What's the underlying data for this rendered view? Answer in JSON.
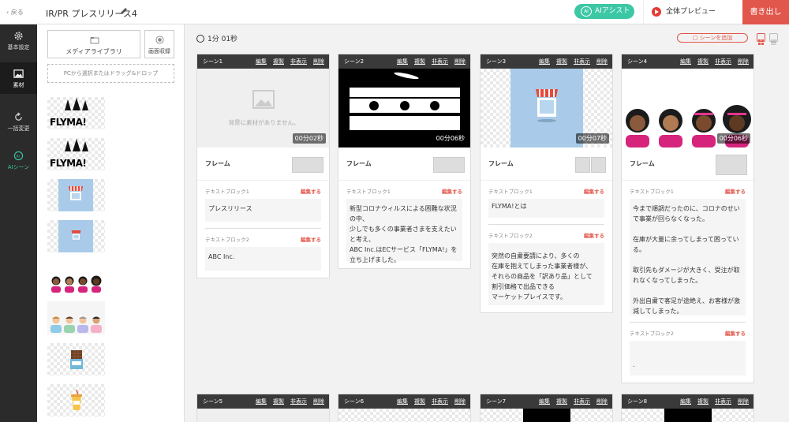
{
  "header": {
    "back": "戻る",
    "title": "IR/PR プレスリリース4",
    "ai_assist": "AIアシスト",
    "preview": "全体プレビュー",
    "export": "書き出し"
  },
  "nav": [
    {
      "label": "基本設定",
      "icon": "gear-icon"
    },
    {
      "label": "素材",
      "icon": "image-icon"
    },
    {
      "label": "一括変更",
      "icon": "refresh-icon"
    },
    {
      "label": "AIシーン",
      "icon": "ai-icon"
    }
  ],
  "library": {
    "media": "メディアライブラリ",
    "record": "画面収録",
    "drop": "PCから選択またはドラッグ&ドロップ",
    "flyma": "FLYMA!"
  },
  "main": {
    "timer": "1分 01秒",
    "add_scene": "シーンを追加"
  },
  "cards": [
    {
      "scene": "シーン1",
      "edit": "編集",
      "copy": "複製",
      "hide": "非表示",
      "del": "削除",
      "empty": "背景に素材がありません。",
      "time": "00分02秒",
      "frame": "フレーム",
      "blocks": [
        {
          "label": "テキストブロック1",
          "edit": "編集する",
          "text": "プレスリリース"
        },
        {
          "label": "テキストブロック2",
          "edit": "編集する",
          "text": "ABC Inc."
        }
      ]
    },
    {
      "scene": "シーン2",
      "edit": "編集",
      "copy": "複製",
      "hide": "非表示",
      "del": "削除",
      "time": "00分06秒",
      "frame": "フレーム",
      "blocks": [
        {
          "label": "テキストブロック1",
          "edit": "編集する",
          "text": "新型コロナウィルスによる困難な状況の中、\n少しでも多くの事業者さまを支えたいと考え、\nABC Inc.はECサービス「FLYMA!」を立ち上げました。"
        }
      ]
    },
    {
      "scene": "シーン3",
      "edit": "編集",
      "copy": "複製",
      "hide": "非表示",
      "del": "削除",
      "time": "00分07秒",
      "frame": "フレーム",
      "blocks": [
        {
          "label": "テキストブロック1",
          "edit": "編集する",
          "text": "FLYMA!とは"
        },
        {
          "label": "テキストブロック2",
          "edit": "編集する",
          "text": "突然の自粛要請により、多くの\n在庫を抱えてしまった事業者様が、\nそれらの商品を「訳あり品」として\n割引価格で出品できる\nマーケットプレイスです。"
        }
      ]
    },
    {
      "scene": "シーン4",
      "edit": "編集",
      "copy": "複製",
      "hide": "非表示",
      "del": "削除",
      "time": "00分06秒",
      "frame": "フレーム",
      "blocks": [
        {
          "label": "テキストブロック1",
          "edit": "編集する",
          "text": "今まで順調だったのに、コロナのせいで事業が回らなくなった。\n\n在庫が大量に余ってしまって困っている。\n\n取引先もダメージが大きく、受注が取れなくなってしまった。\n\n外出自粛で客足が途絶え、お客様が激減してしまった。"
        },
        {
          "label": "テキストブロック2",
          "edit": "編集する",
          "text": "."
        }
      ]
    },
    {
      "scene": "シーン5",
      "edit": "編集",
      "copy": "複製",
      "hide": "非表示",
      "del": "削除"
    },
    {
      "scene": "シーン6",
      "edit": "編集",
      "copy": "複製",
      "hide": "非表示",
      "del": "削除"
    },
    {
      "scene": "シーン7",
      "edit": "編集",
      "copy": "複製",
      "hide": "非表示",
      "del": "削除"
    },
    {
      "scene": "シーン8",
      "edit": "編集",
      "copy": "複製",
      "hide": "非表示",
      "del": "削除"
    }
  ],
  "colors": {
    "accent": "#e2574c",
    "ai": "#3cc7a5",
    "dark": "#2b2b2b"
  }
}
